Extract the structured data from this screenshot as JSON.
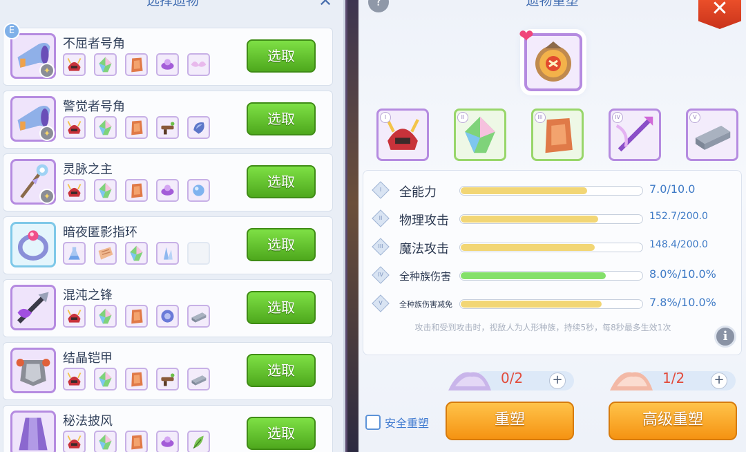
{
  "left_panel": {
    "title": "选择遗物",
    "close_glyph": "✕",
    "items": [
      {
        "name": "不屈者号角",
        "button": "选取",
        "badge": "E",
        "icon": "horn-icon",
        "frame": "purple",
        "materials": [
          "helmet-icon",
          "crystal-icon",
          "stone-icon",
          "purple-orb-icon",
          "wing-icon"
        ]
      },
      {
        "name": "警觉者号角",
        "button": "选取",
        "icon": "horn-icon",
        "frame": "purple",
        "materials": [
          "helmet-icon",
          "crystal-icon",
          "stone-icon",
          "gun-icon",
          "gem-icon"
        ]
      },
      {
        "name": "灵脉之主",
        "button": "选取",
        "icon": "staff-icon",
        "frame": "purple",
        "materials": [
          "helmet-icon",
          "crystal-icon",
          "stone-icon",
          "purple-orb-icon",
          "blue-orb-icon"
        ]
      },
      {
        "name": "暗夜匿影指环",
        "button": "选取",
        "icon": "ring-icon",
        "frame": "blue",
        "materials": [
          "potion-icon",
          "plank-icon",
          "crystal-icon",
          "ice-icon",
          "empty"
        ]
      },
      {
        "name": "混沌之锋",
        "button": "选取",
        "icon": "sword-icon",
        "frame": "purple",
        "materials": [
          "helmet-icon",
          "crystal-icon",
          "stone-icon",
          "dark-orb-icon",
          "ingot-icon"
        ]
      },
      {
        "name": "结晶铠甲",
        "button": "选取",
        "icon": "armor-icon",
        "frame": "purple",
        "materials": [
          "helmet-icon",
          "crystal-icon",
          "stone-icon",
          "gun-icon",
          "ingot-icon"
        ]
      },
      {
        "name": "秘法披风",
        "button": "选取",
        "icon": "cloak-icon",
        "frame": "purple",
        "materials": [
          "helmet-icon",
          "crystal-icon",
          "stone-icon",
          "purple-orb-icon",
          "leaf-icon"
        ]
      }
    ]
  },
  "right_panel": {
    "title": "遗物重塑",
    "help_glyph": "?",
    "close_glyph": "✕",
    "heart_glyph": "❤",
    "main_item_icon": "clock-relic-icon",
    "slots": [
      {
        "roman": "I",
        "icon": "helmet-icon",
        "frame": "purple"
      },
      {
        "roman": "II",
        "icon": "crystal-icon",
        "frame": "green"
      },
      {
        "roman": "III",
        "icon": "stone-icon",
        "frame": "green"
      },
      {
        "roman": "IV",
        "icon": "spear-icon",
        "frame": "purple"
      },
      {
        "roman": "V",
        "icon": "ingot-icon",
        "frame": "purple"
      }
    ],
    "stats": [
      {
        "roman": "I",
        "name": "全能力",
        "value": "7.0/10.0",
        "fill": 0.7,
        "bar_color": "yellow"
      },
      {
        "roman": "II",
        "name": "物理攻击",
        "value": "152.7/200.0",
        "fill": 0.76,
        "bar_color": "yellow"
      },
      {
        "roman": "III",
        "name": "魔法攻击",
        "value": "148.4/200.0",
        "fill": 0.74,
        "bar_color": "yellow"
      },
      {
        "roman": "IV",
        "name": "全种族伤害",
        "value": "8.0%/10.0%",
        "fill": 0.8,
        "bar_color": "green"
      },
      {
        "roman": "V",
        "name": "全种族伤害减免",
        "value": "7.8%/10.0%",
        "fill": 0.78,
        "bar_color": "yellow"
      }
    ],
    "effect_text": "攻击和受到攻击时，视敌人为人形种族，持续5秒，每8秒最多生效1次",
    "info_glyph": "i",
    "materials": [
      {
        "count": "0/2",
        "plus": "+",
        "icon": "purple-powder-icon"
      },
      {
        "count": "1/2",
        "plus": "+",
        "icon": "pink-powder-icon"
      }
    ],
    "safe_label": "安全重塑",
    "reshape_label": "重塑",
    "advanced_label": "高级重塑"
  },
  "colors": {
    "select_green": "#5cb82a",
    "stat_yellow": "#f2d675",
    "stat_green": "#84e06a",
    "count_red": "#e24b3b",
    "orange": "#f59312"
  }
}
